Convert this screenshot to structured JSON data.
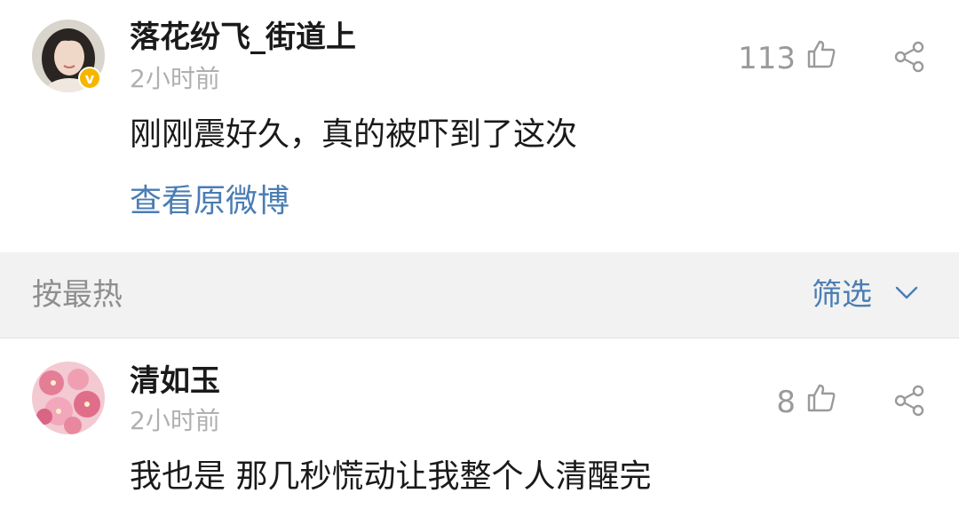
{
  "post": {
    "username": "落花纷飞_街道上",
    "time": "2小时前",
    "content": "刚刚震好久，真的被吓到了这次",
    "view_original": "查看原微博",
    "like_count": "113",
    "verified_badge": "v"
  },
  "sort_bar": {
    "label": "按最热",
    "filter_label": "筛选"
  },
  "comments": [
    {
      "username": "清如玉",
      "time": "2小时前",
      "content": "我也是 那几秒慌动让我整个人清醒完",
      "like_count": "8"
    }
  ],
  "icons": {
    "like": "thumbs-up-icon",
    "share": "share-icon",
    "filter": "chevron-down-icon"
  },
  "colors": {
    "link": "#4a7db3",
    "muted": "#b0b0b0",
    "sort_bg": "#f2f2f2",
    "badge": "#f7b500"
  }
}
